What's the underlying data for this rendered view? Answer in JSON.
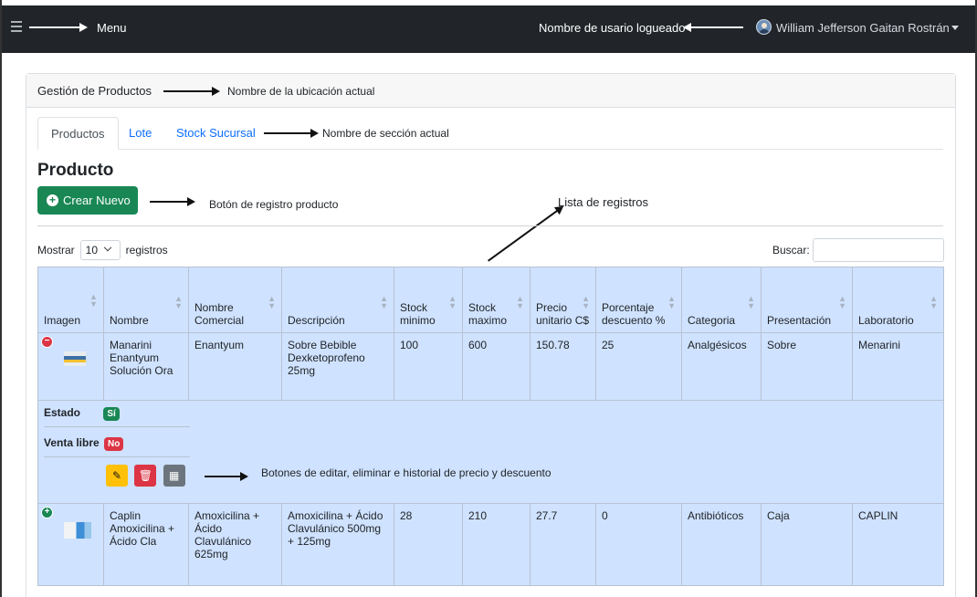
{
  "navbar": {
    "menu_label": "Menu",
    "user_label": "Nombre de usario logueado",
    "user_name": "William Jefferson Gaitan Rostrán"
  },
  "card": {
    "title": "Gestión de Productos",
    "title_annotation": "Nombre de la ubicación actual"
  },
  "tabs": {
    "items": [
      {
        "label": "Productos"
      },
      {
        "label": "Lote"
      },
      {
        "label": "Stock Sucursal"
      }
    ],
    "annotation": "Nombre de sección actual"
  },
  "section": {
    "title": "Producto",
    "new_button": "Crear Nuevo",
    "new_button_annotation": "Botón de registro producto",
    "list_annotation": "Lista de registros"
  },
  "table_controls": {
    "show_label": "Mostrar",
    "show_value": "10",
    "records_label": "registros",
    "search_label": "Buscar:",
    "search_placeholder": ""
  },
  "table": {
    "headers": [
      "Imagen",
      "Nombre",
      "Nombre Comercial",
      "Descripción",
      "Stock minimo",
      "Stock maximo",
      "Precio unitario C$",
      "Porcentaje descuento %",
      "Categoria",
      "Presentación",
      "Laboratorio"
    ],
    "rows": [
      {
        "nombre": "Manarini Enantyum Solución Ora",
        "comercial": "Enantyum",
        "descripcion": "Sobre Bebible Dexketoprofeno 25mg",
        "stock_min": "100",
        "stock_max": "600",
        "precio": "150.78",
        "descuento": "25",
        "categoria": "Analgésicos",
        "presentacion": "Sobre",
        "laboratorio": "Menarini"
      },
      {
        "nombre": "Caplin Amoxicilina + Ácido Cla",
        "comercial": "Amoxicilina + Ácido Clavulánico 625mg",
        "descripcion": "Amoxicilina + Ácido Clavulánico 500mg + 125mg",
        "stock_min": "28",
        "stock_max": "210",
        "precio": "27.7",
        "descuento": "0",
        "categoria": "Antibióticos",
        "presentacion": "Caja",
        "laboratorio": "CAPLIN"
      }
    ],
    "detail": {
      "estado_label": "Estado",
      "estado_value": "Sí",
      "venta_label": "Venta libre",
      "venta_value": "No",
      "actions_annotation": "Botones de editar, eliminar e historial de precio y descuento"
    }
  }
}
